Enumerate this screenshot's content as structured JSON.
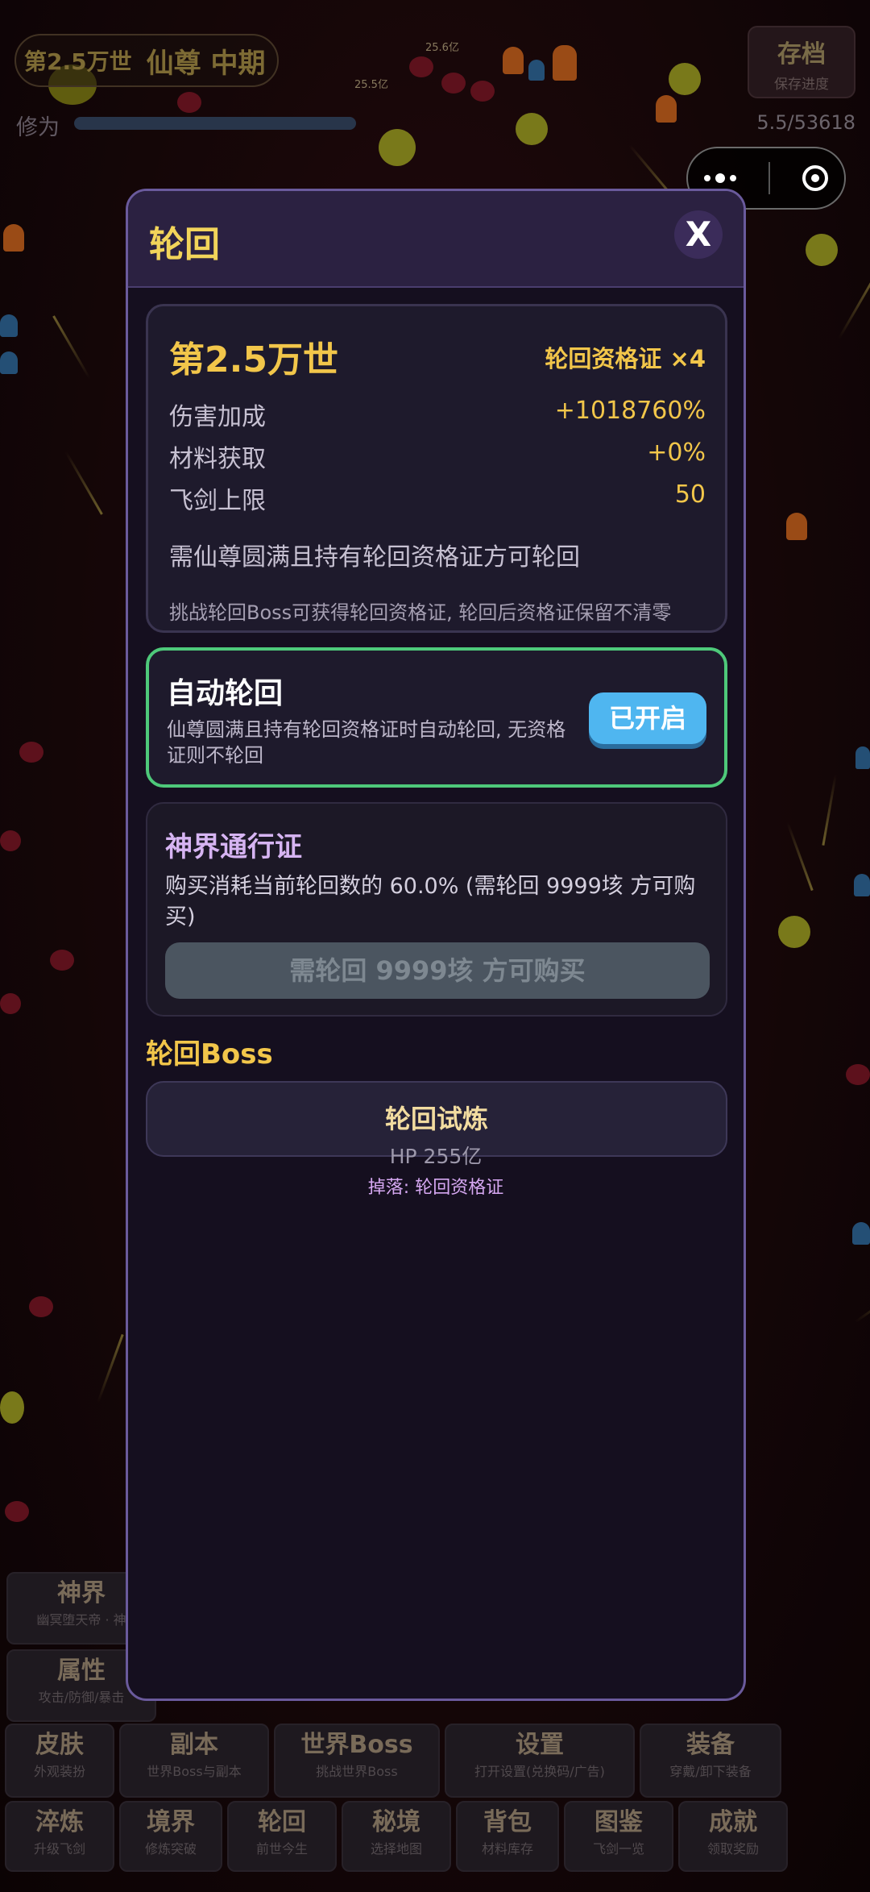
{
  "header": {
    "era": "第2.5万世",
    "rank": "仙尊 中期",
    "save_label": "存档",
    "save_sub": "保存进度",
    "cultivation_label": "修为",
    "cultivation_value": "5.5/53618",
    "cultivation_progress": 0.0001
  },
  "scene_labels": {
    "damage_a": "25.6亿",
    "damage_b": "25.5亿"
  },
  "modal": {
    "title": "轮回",
    "close_label": "X",
    "rebirth": {
      "era_title": "第2.5万世",
      "cert_label": "轮回资格证 ×4",
      "stats": [
        {
          "key": "伤害加成",
          "value": "+1018760%"
        },
        {
          "key": "材料获取",
          "value": "+0%"
        },
        {
          "key": "飞剑上限",
          "value": "50"
        }
      ],
      "requirement": "需仙尊圆满且持有轮回资格证方可轮回",
      "hint": "挑战轮回Boss可获得轮回资格证, 轮回后资格证保留不清零"
    },
    "auto": {
      "title": "自动轮回",
      "desc": "仙尊圆满且持有轮回资格证时自动轮回, 无资格证则不轮回",
      "toggle_label": "已开启"
    },
    "pass": {
      "title": "神界通行证",
      "desc": "购买消耗当前轮回数的 60.0% (需轮回 9999垓 方可购买)",
      "button_label": "需轮回 9999垓 方可购买"
    },
    "boss": {
      "heading": "轮回Boss",
      "name": "轮回试炼",
      "hp": "HP 255亿",
      "drop": "掉落: 轮回资格证"
    }
  },
  "bottom_menu": {
    "row1": [
      {
        "title": "神界",
        "sub": "幽冥堕天帝 · 神"
      }
    ],
    "row2": [
      {
        "title": "属性",
        "sub": "攻击/防御/暴击"
      }
    ],
    "row3": [
      {
        "title": "皮肤",
        "sub": "外观装扮"
      },
      {
        "title": "副本",
        "sub": "世界Boss与副本"
      },
      {
        "title": "世界Boss",
        "sub": "挑战世界Boss"
      },
      {
        "title": "设置",
        "sub": "打开设置(兑换码/广告)"
      },
      {
        "title": "装备",
        "sub": "穿戴/卸下装备"
      }
    ],
    "row4": [
      {
        "title": "淬炼",
        "sub": "升级飞剑"
      },
      {
        "title": "境界",
        "sub": "修炼突破"
      },
      {
        "title": "轮回",
        "sub": "前世今生"
      },
      {
        "title": "秘境",
        "sub": "选择地图"
      },
      {
        "title": "背包",
        "sub": "材料库存"
      },
      {
        "title": "图鉴",
        "sub": "飞剑一览"
      },
      {
        "title": "成就",
        "sub": "领取奖励"
      }
    ]
  },
  "colors": {
    "accent_gold": "#f2c64a",
    "auto_border": "#4ec97a",
    "toggle_blue": "#4fb6f0",
    "pass_title": "#d6b4f2",
    "modal_border": "#6a5a9c"
  }
}
